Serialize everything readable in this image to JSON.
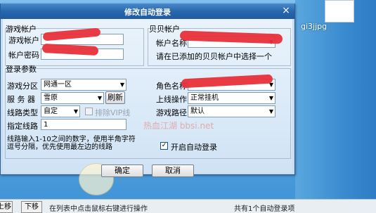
{
  "desktop": {
    "file_label": "gi3jjpg",
    "bottom_buttons": [
      "上移",
      "下移"
    ],
    "bottom_hint": "在列表中点击鼠标右键进行操作",
    "bottom_status": "共有1个自动登录项"
  },
  "dialog": {
    "title": "修改自动登录",
    "close_glyph": "×",
    "game_account": {
      "legend": "游戏帐户",
      "account_label": "游戏帐户",
      "password_label": "帐户密码"
    },
    "beibei_account": {
      "legend": "贝贝帐户",
      "name_label": "帐户名称",
      "hint": "请在已添加的贝贝帐户中选择一个"
    },
    "login_params": {
      "legend": "登录参数",
      "zone_label": "游戏分区",
      "zone_value": "网通一区",
      "server_label": "服 务 器",
      "server_value": "雪原",
      "refresh_label": "刷新",
      "line_type_label": "线路类型",
      "line_type_value": "自定",
      "exclude_vip_label": "排除VIP线",
      "custom_line_label": "指定线路",
      "custom_line_value": "1",
      "line_note_1": "线路输入1-10之间的数字，使用半角字符",
      "line_note_2": "逗号分隔，优先使用最左边的线路",
      "role_label": "角色名称",
      "online_action_label": "上线操作",
      "online_action_value": "正常挂机",
      "route_label": "游戏路径",
      "route_value": "默认",
      "auto_login_label": "开启自动登录",
      "auto_login_checked": true
    },
    "buttons": {
      "ok": "确定",
      "cancel": "取消"
    }
  },
  "watermark": "热血江湖 bbsi.net",
  "colors": {
    "title_bar": "#2767ad",
    "redaction": "#e8303a"
  }
}
